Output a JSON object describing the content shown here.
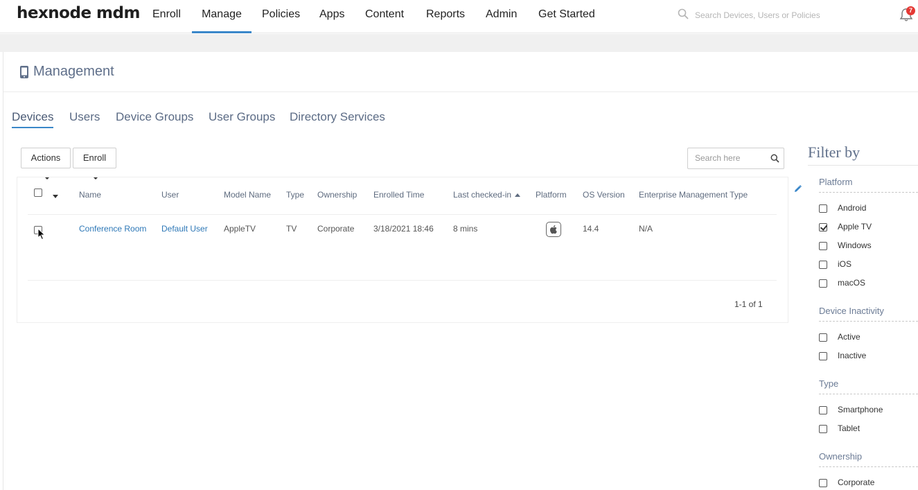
{
  "app": {
    "logo": "hexnode mdm"
  },
  "nav": {
    "items": [
      "Enroll",
      "Manage",
      "Policies",
      "Apps",
      "Content",
      "Reports",
      "Admin",
      "Get Started"
    ],
    "active": "Manage",
    "search_placeholder": "Search Devices, Users or Policies",
    "notification_count": "7"
  },
  "header": {
    "title": "Management",
    "icon": "mobile-device-icon"
  },
  "tabs": [
    "Devices",
    "Users",
    "Device Groups",
    "User Groups",
    "Directory Services"
  ],
  "toolbar": {
    "actions_label": "Actions",
    "enroll_label": "Enroll",
    "search_placeholder": "Search here"
  },
  "table": {
    "columns": [
      "Name",
      "User",
      "Model Name",
      "Type",
      "Ownership",
      "Enrolled Time",
      "Last checked-in",
      "Platform",
      "OS Version",
      "Enterprise Management Type"
    ],
    "sorted_column": "Last checked-in",
    "rows": [
      {
        "name": "Conference Room",
        "user": "Default User",
        "model": "AppleTV",
        "type": "TV",
        "ownership": "Corporate",
        "enrolled": "3/18/2021 18:46",
        "last_checked": "8 mins",
        "platform": "apple-icon",
        "os_version": "14.4",
        "emt": "N/A"
      }
    ],
    "pagination": "1-1 of 1"
  },
  "filter": {
    "title": "Filter by",
    "sections": [
      {
        "title": "Platform",
        "options": [
          {
            "label": "Android",
            "checked": false
          },
          {
            "label": "Apple TV",
            "checked": true
          },
          {
            "label": "Windows",
            "checked": false
          },
          {
            "label": "iOS",
            "checked": false
          },
          {
            "label": "macOS",
            "checked": false
          }
        ]
      },
      {
        "title": "Device Inactivity",
        "options": [
          {
            "label": "Active",
            "checked": false
          },
          {
            "label": "Inactive",
            "checked": false
          }
        ]
      },
      {
        "title": "Type",
        "options": [
          {
            "label": "Smartphone",
            "checked": false
          },
          {
            "label": "Tablet",
            "checked": false
          }
        ]
      },
      {
        "title": "Ownership",
        "options": [
          {
            "label": "Corporate",
            "checked": false
          }
        ]
      }
    ]
  },
  "colors": {
    "accent": "#3a87c9",
    "link": "#2e78b7",
    "heading": "#5f6f8a",
    "badge": "#e53935"
  }
}
